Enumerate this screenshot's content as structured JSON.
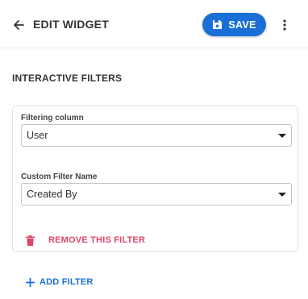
{
  "header": {
    "title": "EDIT WIDGET",
    "save_label": "SAVE",
    "back_icon": "arrow-left-icon",
    "save_icon": "floppy-disk-icon",
    "menu_icon": "more-vert-icon"
  },
  "section": {
    "title": "INTERACTIVE FILTERS"
  },
  "filter": {
    "column_label": "Filtering column",
    "column_value": "User",
    "name_label": "Custom Filter Name",
    "name_value": "Created By",
    "remove_label": "REMOVE THIS FILTER",
    "remove_icon": "trash-icon"
  },
  "add_filter": {
    "label": "ADD FILTER",
    "icon": "plus-icon"
  },
  "colors": {
    "primary": "#1a6fd6",
    "danger": "#e0456a"
  }
}
